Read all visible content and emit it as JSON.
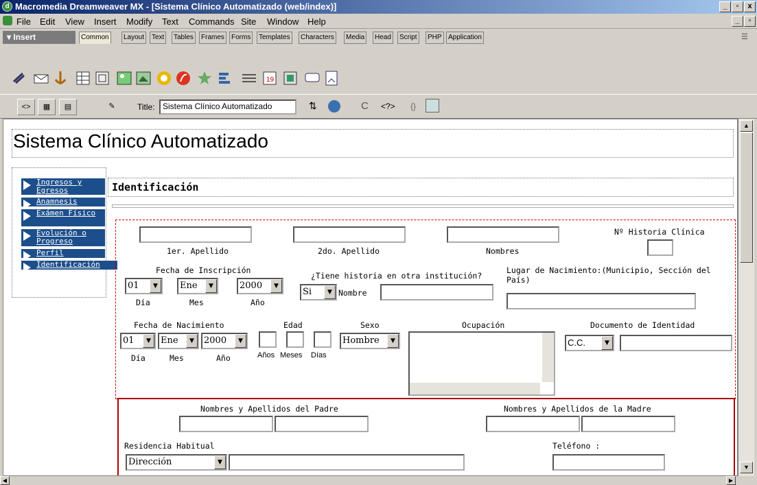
{
  "window": {
    "title": "Macromedia Dreamweaver MX - [Sistema Clínico Automatizado (web/index)]",
    "app_icon": "dreamweaver-icon",
    "controls": [
      "_",
      "8",
      "x"
    ]
  },
  "menu": [
    "File",
    "Edit",
    "View",
    "Insert",
    "Modify",
    "Text",
    "Commands",
    "Site",
    "Window",
    "Help"
  ],
  "insert_bar": {
    "title": "▾ Insert",
    "tabs": [
      "Common",
      "Layout",
      "Text",
      "Tables",
      "Frames",
      "Forms",
      "Templates",
      "Characters",
      "Media",
      "Head",
      "Script",
      "PHP",
      "Application"
    ],
    "active_tab": "Common"
  },
  "doc_toolbar": {
    "title_label": "Title:",
    "title_value": "Sistema Clínico Automatizado"
  },
  "page": {
    "heading": "Sistema Clínico Automatizado",
    "section": "Identificación",
    "nav": [
      "Ingresos y Egresos",
      "Anamnesis",
      "Exámen Físico",
      "Evolución o Progreso",
      "Perfil",
      "Identificación"
    ],
    "labels": {
      "ap1": "1er. Apellido",
      "ap2": "2do. Apellido",
      "nombres": "Nombres",
      "historia": "Nº Historia Clínica",
      "fecha_insc": "Fecha de Inscripción",
      "dia": "Día",
      "mes": "Mes",
      "anio": "Año",
      "otra_inst": "¿Tiene historia en otra institución?",
      "nombre": "Nombre",
      "lugar_nac": "Lugar de Nacimiento:(Municipio, Sección del País)",
      "fecha_nac": "Fecha de Nacimiento",
      "edad": "Edad",
      "sexo": "Sexo",
      "ocupacion": "Ocupación",
      "documento": "Documento de Identidad",
      "anios": "Años",
      "meses": "Meses",
      "dias": "Días",
      "padre": "Nombres y Apellidos del Padre",
      "madre": "Nombres y Apellidos de la Madre",
      "residencia": "Residencia Habitual",
      "telefono": "Teléfono :"
    },
    "selects": {
      "dia": "01",
      "mes": "Ene",
      "anio": "2000",
      "si": "Si",
      "sexo": "Hombre",
      "doc": "C.C.",
      "direccion": "Dirección"
    }
  },
  "colors": {
    "titlebar": "#0a246a",
    "nav_bg": "#1c4e8b",
    "form_border": "#c00000"
  }
}
